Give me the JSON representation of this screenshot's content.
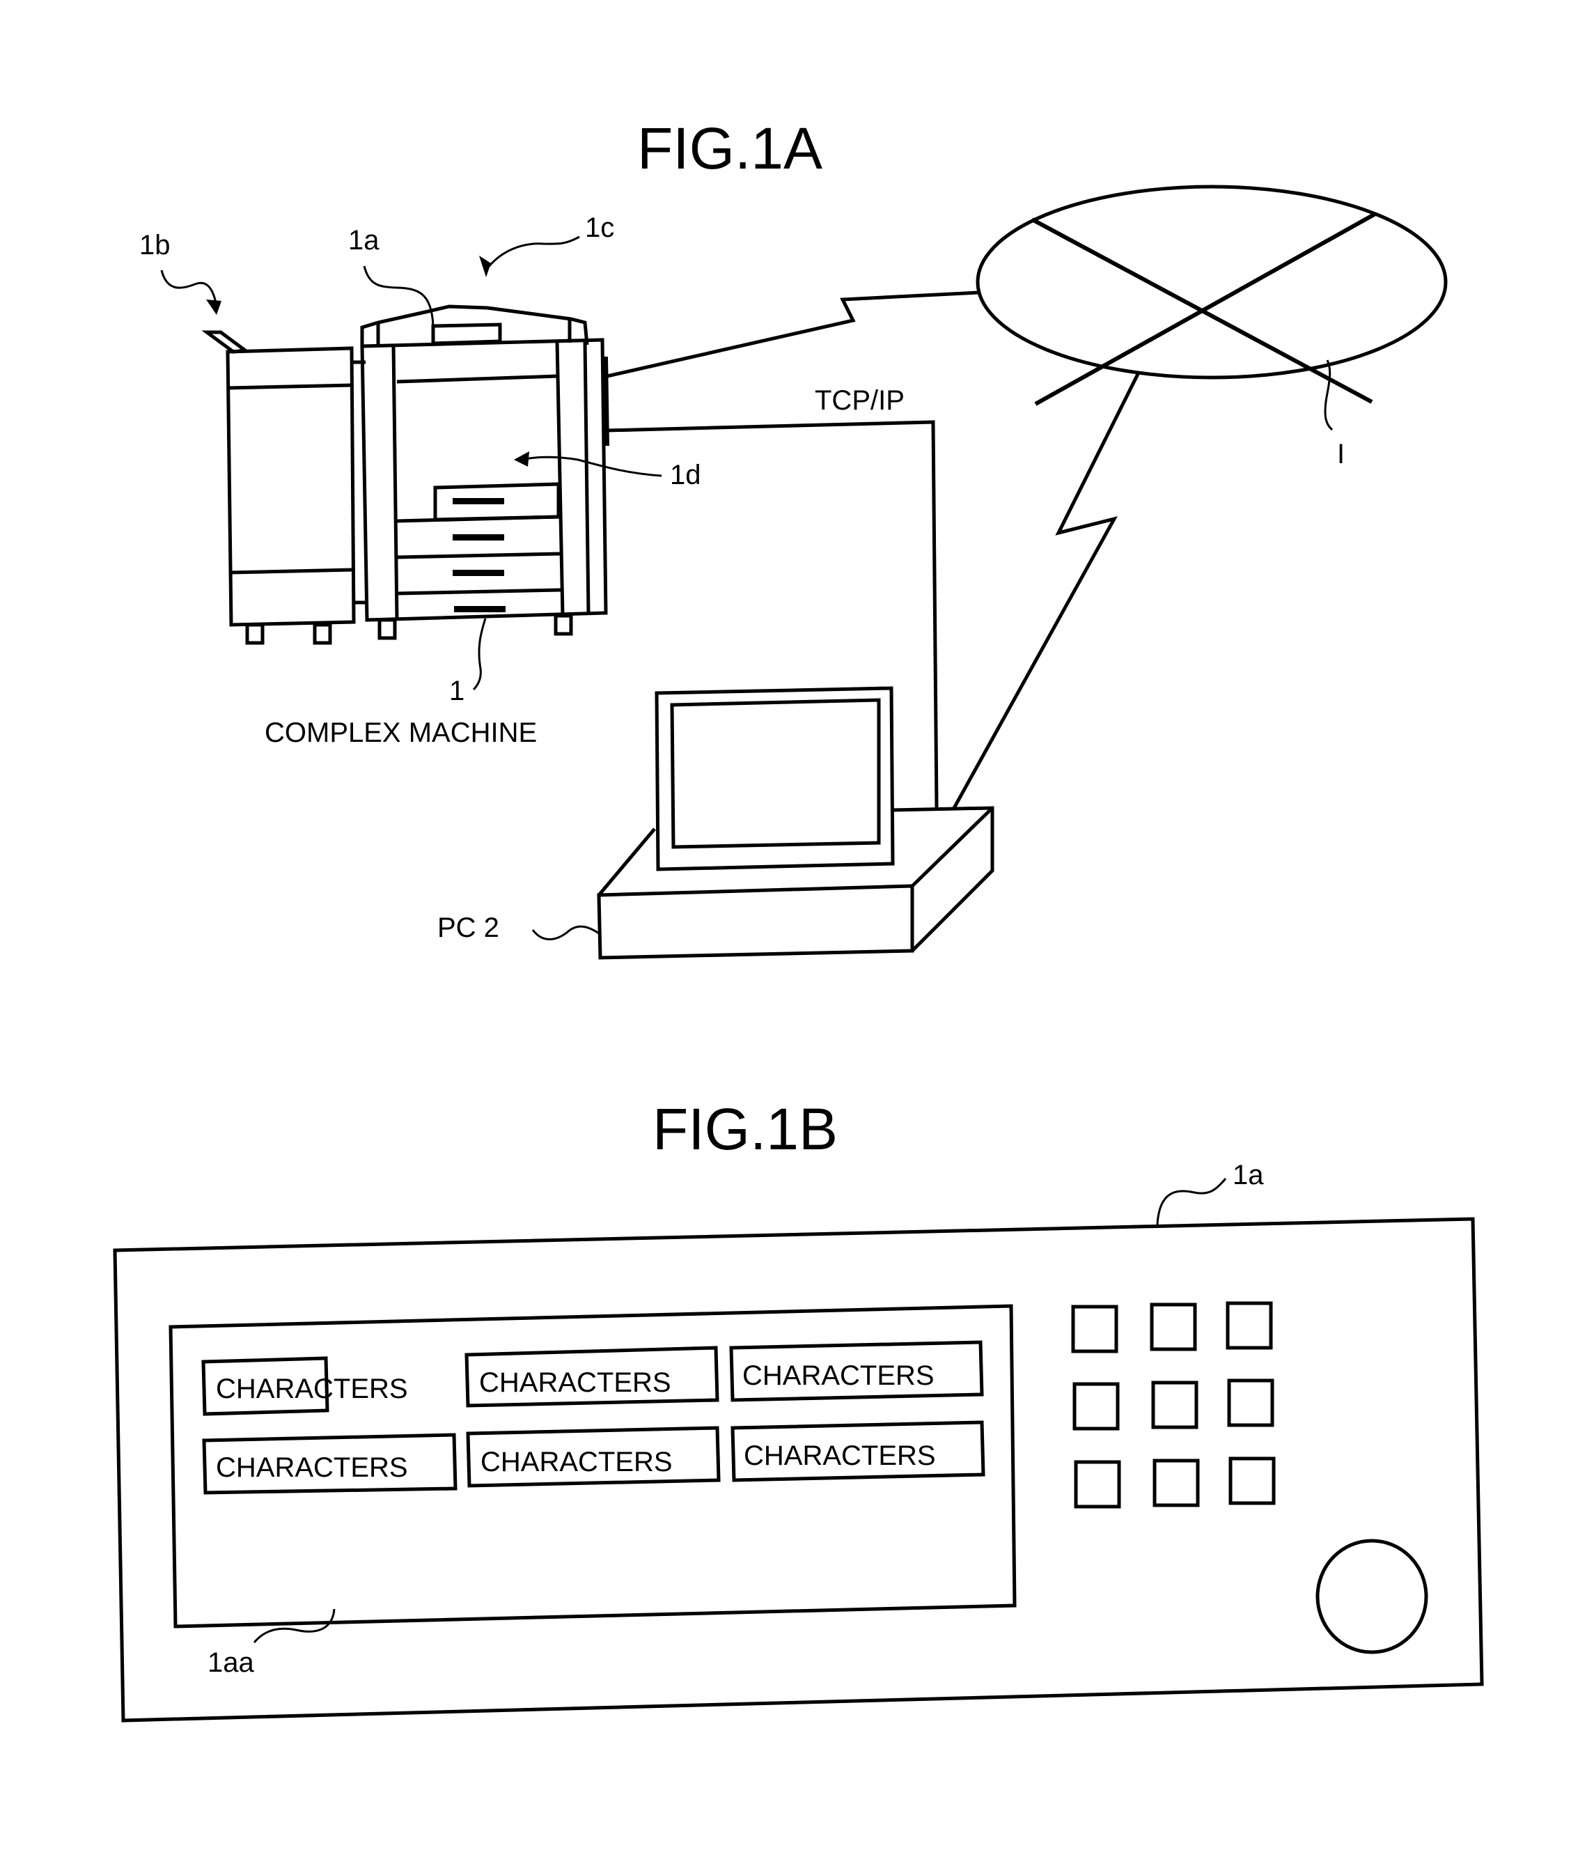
{
  "figures": {
    "fig1a": {
      "title": "FIG.1A",
      "refs": {
        "finisher": "1b",
        "operation_panel": "1a",
        "scanner": "1c",
        "printer": "1d",
        "machine": "1",
        "network": "I",
        "pc_ref": "PC  2"
      },
      "labels": {
        "machine_name": "COMPLEX MACHINE",
        "protocol": "TCP/IP"
      },
      "paper_trays": 4
    },
    "fig1b": {
      "title": "FIG.1B",
      "refs": {
        "operation_panel": "1a",
        "display": "1aa"
      },
      "display_buttons": [
        [
          "CHARACTERS",
          "CHARACTERS",
          "CHARACTERS"
        ],
        [
          "CHARACTERS",
          "CHARACTERS",
          "CHARACTERS"
        ]
      ],
      "keypad": {
        "rows": 3,
        "cols": 3
      },
      "has_dial": true
    }
  },
  "colors": {
    "ink": "#000000",
    "paper": "#ffffff"
  }
}
